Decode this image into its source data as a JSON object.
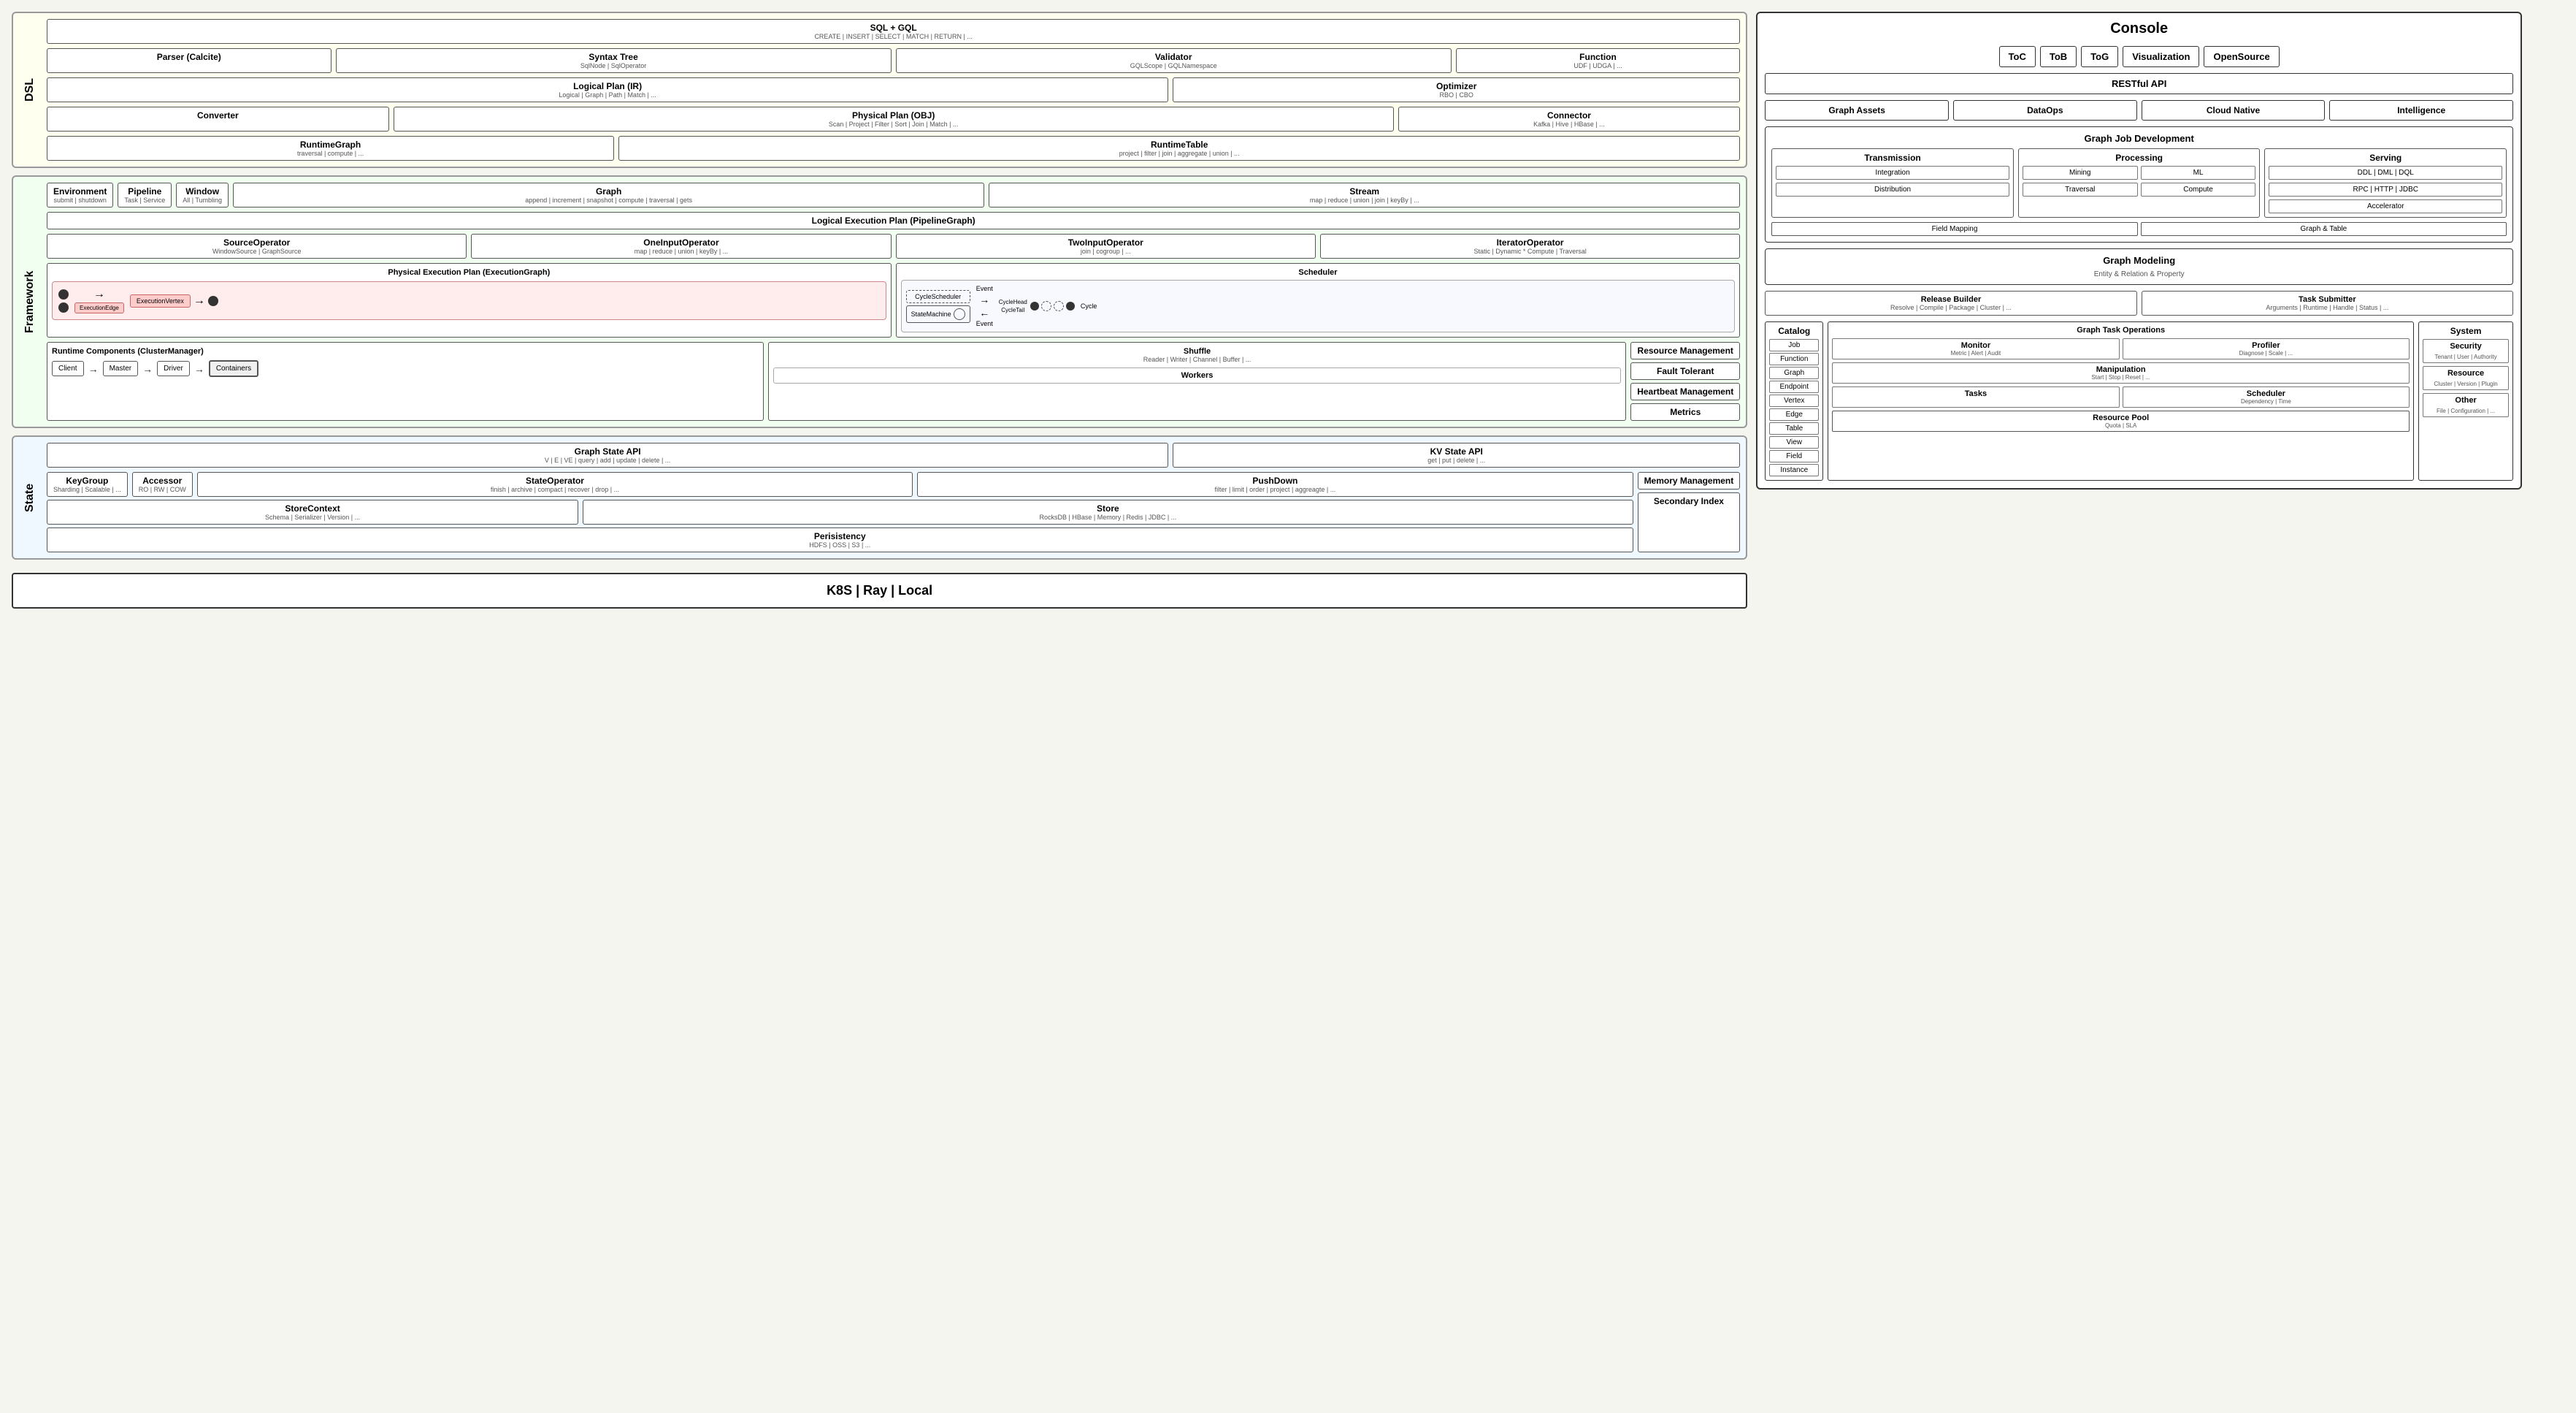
{
  "dsl": {
    "label": "DSL",
    "sql_gql": {
      "title": "SQL + GQL",
      "sub": "CREATE | INSERT | SELECT | MATCH | RETURN | ..."
    },
    "parser": {
      "title": "Parser (Calcite)"
    },
    "syntax_tree": {
      "title": "Syntax Tree",
      "sub": "SqlNode | SqlOperator"
    },
    "validator": {
      "title": "Validator",
      "sub": "GQLScope | GQLNamespace"
    },
    "function": {
      "title": "Function",
      "sub": "UDF | UDGA | ..."
    },
    "logical_plan": {
      "title": "Logical Plan (IR)",
      "sub": "Logical | Graph | Path | Match | ..."
    },
    "optimizer": {
      "title": "Optimizer",
      "sub": "RBO | CBO"
    },
    "converter": {
      "title": "Converter"
    },
    "physical_plan": {
      "title": "Physical Plan (OBJ)",
      "sub": "Scan | Project | Filter | Sort | Join | Match | ..."
    },
    "connector": {
      "title": "Connector",
      "sub": "Kafka | Hive | HBase | ..."
    },
    "runtime_graph": {
      "title": "RuntimeGraph",
      "sub": "traversal | compute | ..."
    },
    "runtime_table": {
      "title": "RuntimeTable",
      "sub": "project | filter | join | aggregate | union | ..."
    }
  },
  "framework": {
    "label": "Framework",
    "environment": {
      "title": "Environment",
      "sub": "submit | shutdown"
    },
    "pipeline": {
      "title": "Pipeline",
      "sub": "Task | Service"
    },
    "window": {
      "title": "Window",
      "sub": "All | Tumbling"
    },
    "graph": {
      "title": "Graph",
      "sub": "append | increment | snapshot | compute | traversal | gets"
    },
    "stream": {
      "title": "Stream",
      "sub": "map | reduce | union | join | keyBy | ..."
    },
    "logical_exec": {
      "title": "Logical Execution Plan (PipelineGraph)"
    },
    "source_op": {
      "title": "SourceOperator",
      "sub": "WindowSource | GraphSource"
    },
    "one_input_op": {
      "title": "OneInputOperator",
      "sub": "map | reduce | union | keyBy | ..."
    },
    "two_input_op": {
      "title": "TwoInputOperator",
      "sub": "join | cogroup | ..."
    },
    "iterator_op": {
      "title": "IteratorOperator",
      "sub": "Static | Dynamic * Compute | Traversal"
    },
    "physical_exec": {
      "title": "Physical Execution Plan (ExecutionGraph)"
    },
    "execution_edge": "ExecutionEdge",
    "execution_vertex": "ExecutionVertex",
    "scheduler": {
      "title": "Scheduler"
    },
    "cycle_scheduler": "CycleScheduler",
    "state_machine": "StateMachine",
    "cycle_head": "CycleHead",
    "cycle_tail": "CycleTail",
    "cycle": "Cycle",
    "event": "Event",
    "runtime_components": {
      "title": "Runtime Components (ClusterManager)"
    },
    "client": "Client",
    "master": "Master",
    "driver": "Driver",
    "containers": "Containers",
    "shuffle": {
      "title": "Shuffle",
      "sub": "Reader | Writer | Channel | Buffer | ..."
    },
    "workers": {
      "title": "Workers"
    },
    "resource_mgmt": {
      "title": "Resource Management"
    },
    "fault_tolerant": {
      "title": "Fault Tolerant"
    },
    "heartbeat": {
      "title": "Heartbeat Management"
    },
    "metrics": {
      "title": "Metrics"
    }
  },
  "state": {
    "label": "State",
    "graph_state_api": {
      "title": "Graph State API",
      "sub": "V | E | VE | query | add | update | delete | ..."
    },
    "kv_state_api": {
      "title": "KV State API",
      "sub": "get | put | delete | ..."
    },
    "keygroup": {
      "title": "KeyGroup",
      "sub": "Sharding | Scalable | ..."
    },
    "accessor": {
      "title": "Accessor",
      "sub": "RO | RW | COW"
    },
    "state_operator": {
      "title": "StateOperator",
      "sub": "finish | archive | compact | recover | drop | ..."
    },
    "pushdown": {
      "title": "PushDown",
      "sub": "filter | limit | order | project | aggreagte | ..."
    },
    "memory_mgmt": {
      "title": "Memory Management"
    },
    "store_context": {
      "title": "StoreContext",
      "sub": "Schema | Serializer | Version | ..."
    },
    "store": {
      "title": "Store",
      "sub": "RocksDB | HBase | Memory | Redis | JDBC | ..."
    },
    "secondary_index": {
      "title": "Secondary Index"
    },
    "persistency": {
      "title": "Perisistency",
      "sub": "HDFS | OSS | S3 | ..."
    }
  },
  "bottom": {
    "label": "K8S | Ray | Local"
  },
  "console": {
    "title": "Console",
    "buttons": {
      "toc": "ToC",
      "tob": "ToB",
      "tog": "ToG",
      "visualization": "Visualization",
      "opensource": "OpenSource"
    },
    "restful": "RESTful API",
    "graph_assets": "Graph Assets",
    "dataops": "DataOps",
    "cloud_native": "Cloud Native",
    "intelligence": "Intelligence",
    "graph_job_dev": "Graph Job Development",
    "transmission": {
      "title": "Transmission",
      "integration": "Integration",
      "distribution": "Distribution"
    },
    "processing": {
      "title": "Processing",
      "mining": "Mining",
      "ml": "ML",
      "traversal": "Traversal",
      "compute": "Compute"
    },
    "serving": {
      "title": "Serving",
      "ddl": "DDL | DML | DQL",
      "rpc": "RPC | HTTP | JDBC",
      "accelerator": "Accelerator"
    },
    "field_mapping": "Field Mapping",
    "graph_table": "Graph & Table",
    "graph_modeling": {
      "title": "Graph Modeling",
      "sub": "Entity & Relation & Property"
    },
    "release_builder": {
      "title": "Release Builder",
      "sub": "Resolve | Compile | Package | Cluster | ..."
    },
    "task_submitter": {
      "title": "Task Submitter",
      "sub": "Arguments | Runtime | Handle | Status | ..."
    },
    "catalog": "Catalog",
    "catalog_items": [
      "Job",
      "Function",
      "Graph",
      "Endpoint",
      "Vertex",
      "Edge",
      "Table",
      "View",
      "Field",
      "Instance"
    ],
    "graph_task_ops": "Graph Task Operations",
    "monitor": {
      "title": "Monitor",
      "sub": "Metric | Alert | Audit"
    },
    "profiler": {
      "title": "Profiler",
      "sub": "Diagnose | Scale | ..."
    },
    "manipulation": {
      "title": "Manipulation",
      "sub": "Start | Stop | Reset | ..."
    },
    "scheduler_console": {
      "title": "Scheduler",
      "sub": "Dependency | Time"
    },
    "tasks": "Tasks",
    "resource_pool": {
      "title": "Resource Pool",
      "sub": "Quota | SLA"
    },
    "system": "System",
    "security": {
      "title": "Security",
      "sub": "Tenant | User | Authority"
    },
    "resource": {
      "title": "Resource",
      "sub": "Cluster | Version | Plugin"
    },
    "other": {
      "title": "Other",
      "sub": "File | Configuration | ..."
    }
  }
}
